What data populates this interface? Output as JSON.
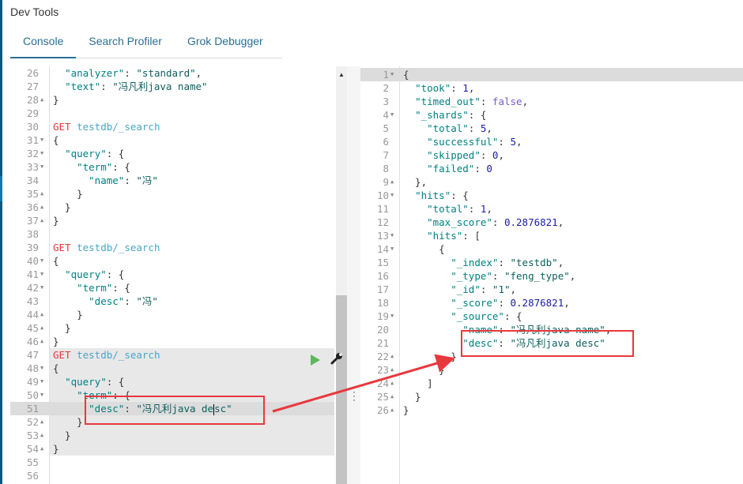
{
  "app": {
    "title": "Dev Tools"
  },
  "tabs": [
    {
      "label": "Console",
      "active": true
    },
    {
      "label": "Search Profiler",
      "active": false
    },
    {
      "label": "Grok Debugger",
      "active": false
    }
  ],
  "request_editor": {
    "lines": [
      {
        "n": "26",
        "fold": "",
        "html": "  <span class='k'>\"analyzer\"</span>: <span class='str'>\"standard\"</span>,"
      },
      {
        "n": "27",
        "fold": "",
        "html": "  <span class='k'>\"text\"</span>: <span class='str'>\"冯凡利java name\"</span>"
      },
      {
        "n": "28",
        "fold": "▲",
        "html": "}"
      },
      {
        "n": "29",
        "fold": "",
        "html": ""
      },
      {
        "n": "30",
        "fold": "",
        "html": "<span class='m'>GET</span> <span class='u'>testdb/_search</span>"
      },
      {
        "n": "31",
        "fold": "▼",
        "html": "{"
      },
      {
        "n": "32",
        "fold": "▼",
        "html": "  <span class='k'>\"query\"</span>: {"
      },
      {
        "n": "33",
        "fold": "▼",
        "html": "    <span class='k'>\"term\"</span>: {"
      },
      {
        "n": "34",
        "fold": "",
        "html": "      <span class='k'>\"name\"</span>: <span class='str'>\"冯\"</span>"
      },
      {
        "n": "35",
        "fold": "▲",
        "html": "    }"
      },
      {
        "n": "36",
        "fold": "▲",
        "html": "  }"
      },
      {
        "n": "37",
        "fold": "▲",
        "html": "}"
      },
      {
        "n": "38",
        "fold": "",
        "html": ""
      },
      {
        "n": "39",
        "fold": "",
        "html": "<span class='m'>GET</span> <span class='u'>testdb/_search</span>"
      },
      {
        "n": "40",
        "fold": "▼",
        "html": "{"
      },
      {
        "n": "41",
        "fold": "▼",
        "html": "  <span class='k'>\"query\"</span>: {"
      },
      {
        "n": "42",
        "fold": "▼",
        "html": "    <span class='k'>\"term\"</span>: {"
      },
      {
        "n": "43",
        "fold": "",
        "html": "      <span class='k'>\"desc\"</span>: <span class='str'>\"冯\"</span>"
      },
      {
        "n": "44",
        "fold": "▲",
        "html": "    }"
      },
      {
        "n": "45",
        "fold": "▲",
        "html": "  }"
      },
      {
        "n": "46",
        "fold": "▲",
        "html": "}"
      },
      {
        "n": "47",
        "fold": "",
        "html": "<span class='m'>GET</span> <span class='u'>testdb/_search</span>"
      },
      {
        "n": "48",
        "fold": "▼",
        "html": "{"
      },
      {
        "n": "49",
        "fold": "▼",
        "html": "  <span class='k'>\"query\"</span>: {"
      },
      {
        "n": "50",
        "fold": "▼",
        "html": "    <span class='k'>\"term\"</span>: {"
      },
      {
        "n": "51",
        "fold": "",
        "html": "      <span class='k'>\"desc\"</span>: <span class='str'>\"冯凡利java de<span class='cursor'></span>sc\"</span>"
      },
      {
        "n": "52",
        "fold": "▲",
        "html": "    }"
      },
      {
        "n": "53",
        "fold": "▲",
        "html": "  }"
      },
      {
        "n": "54",
        "fold": "▲",
        "html": "}"
      },
      {
        "n": "55",
        "fold": "",
        "html": ""
      },
      {
        "n": "56",
        "fold": "",
        "html": ""
      }
    ]
  },
  "response_editor": {
    "lines": [
      {
        "n": "1",
        "fold": "▼",
        "html": "{"
      },
      {
        "n": "2",
        "fold": "",
        "html": "  <span class='k'>\"took\"</span>: <span class='n'>1</span>,"
      },
      {
        "n": "3",
        "fold": "",
        "html": "  <span class='k'>\"timed_out\"</span>: <span class='b'>false</span>,"
      },
      {
        "n": "4",
        "fold": "▼",
        "html": "  <span class='k'>\"_shards\"</span>: {"
      },
      {
        "n": "5",
        "fold": "",
        "html": "    <span class='k'>\"total\"</span>: <span class='n'>5</span>,"
      },
      {
        "n": "6",
        "fold": "",
        "html": "    <span class='k'>\"successful\"</span>: <span class='n'>5</span>,"
      },
      {
        "n": "7",
        "fold": "",
        "html": "    <span class='k'>\"skipped\"</span>: <span class='n'>0</span>,"
      },
      {
        "n": "8",
        "fold": "",
        "html": "    <span class='k'>\"failed\"</span>: <span class='n'>0</span>"
      },
      {
        "n": "9",
        "fold": "▲",
        "html": "  },"
      },
      {
        "n": "10",
        "fold": "▼",
        "html": "  <span class='k'>\"hits\"</span>: {"
      },
      {
        "n": "11",
        "fold": "",
        "html": "    <span class='k'>\"total\"</span>: <span class='n'>1</span>,"
      },
      {
        "n": "12",
        "fold": "",
        "html": "    <span class='k'>\"max_score\"</span>: <span class='n'>0.2876821</span>,"
      },
      {
        "n": "13",
        "fold": "▼",
        "html": "    <span class='k'>\"hits\"</span>: ["
      },
      {
        "n": "14",
        "fold": "▼",
        "html": "      {"
      },
      {
        "n": "15",
        "fold": "",
        "html": "        <span class='k'>\"_index\"</span>: <span class='str'>\"testdb\"</span>,"
      },
      {
        "n": "16",
        "fold": "",
        "html": "        <span class='k'>\"_type\"</span>: <span class='str'>\"feng_type\"</span>,"
      },
      {
        "n": "17",
        "fold": "",
        "html": "        <span class='k'>\"_id\"</span>: <span class='str'>\"1\"</span>,"
      },
      {
        "n": "18",
        "fold": "",
        "html": "        <span class='k'>\"_score\"</span>: <span class='n'>0.2876821</span>,"
      },
      {
        "n": "19",
        "fold": "▼",
        "html": "        <span class='k'>\"_source\"</span>: {"
      },
      {
        "n": "20",
        "fold": "",
        "html": "          <span class='k'>\"name\"</span>: <span class='str'>\"冯凡利java name\"</span>,"
      },
      {
        "n": "21",
        "fold": "",
        "html": "          <span class='k'>\"desc\"</span>: <span class='str'>\"冯凡利java desc\"</span>"
      },
      {
        "n": "22",
        "fold": "▲",
        "html": "        }"
      },
      {
        "n": "23",
        "fold": "▲",
        "html": "      }"
      },
      {
        "n": "24",
        "fold": "▲",
        "html": "    ]"
      },
      {
        "n": "25",
        "fold": "▲",
        "html": "  }"
      },
      {
        "n": "26",
        "fold": "▲",
        "html": "}"
      }
    ]
  },
  "icons": {
    "run": "play-icon",
    "settings": "wrench-icon"
  },
  "colors": {
    "accent": "#2a6f94",
    "annotation": "#e8383d",
    "run": "#5cb85c"
  }
}
